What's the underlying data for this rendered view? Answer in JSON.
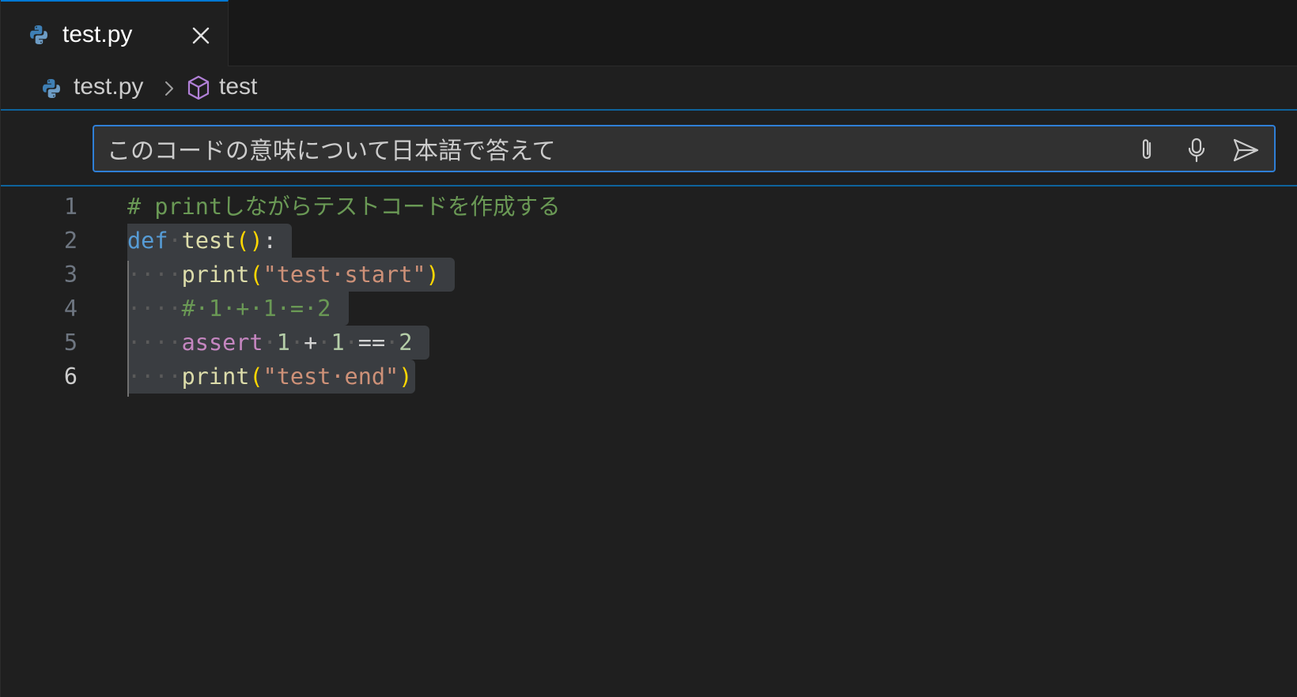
{
  "tab": {
    "label": "test.py",
    "icon": "python-icon"
  },
  "breadcrumb": {
    "file": "test.py",
    "symbol": "test"
  },
  "chat": {
    "prompt": "このコードの意味について日本語で答えて",
    "attach_icon": "paperclip-icon",
    "mic_icon": "microphone-icon",
    "send_icon": "send-icon"
  },
  "editor": {
    "current_line": 6,
    "lines": [
      {
        "number": "1",
        "tokens": [
          [
            "# printしながらテストコードを作成する",
            "comment"
          ]
        ]
      },
      {
        "number": "2",
        "tokens": [
          [
            "def",
            "kw"
          ],
          [
            "·",
            "ws"
          ],
          [
            "test",
            "fn"
          ],
          [
            "()",
            "paren"
          ],
          [
            ":",
            "op"
          ]
        ]
      },
      {
        "number": "3",
        "tokens": [
          [
            "····",
            "ws"
          ],
          [
            "print",
            "fn"
          ],
          [
            "(",
            "paren"
          ],
          [
            "\"test·start\"",
            "str"
          ],
          [
            ")",
            "paren"
          ]
        ]
      },
      {
        "number": "4",
        "tokens": [
          [
            "····",
            "ws"
          ],
          [
            "#·1·+·1·=·2",
            "comment"
          ]
        ]
      },
      {
        "number": "5",
        "tokens": [
          [
            "····",
            "ws"
          ],
          [
            "assert",
            "ctrl"
          ],
          [
            "·",
            "ws"
          ],
          [
            "1",
            "num"
          ],
          [
            "·",
            "ws"
          ],
          [
            "+",
            "op"
          ],
          [
            "·",
            "ws"
          ],
          [
            "1",
            "num"
          ],
          [
            "·",
            "ws"
          ],
          [
            "==",
            "op"
          ],
          [
            "·",
            "ws"
          ],
          [
            "2",
            "num"
          ]
        ]
      },
      {
        "number": "6",
        "tokens": [
          [
            "····",
            "ws"
          ],
          [
            "print",
            "fn"
          ],
          [
            "(",
            "paren"
          ],
          [
            "\"test·end\"",
            "str"
          ],
          [
            ")",
            "paren"
          ]
        ]
      }
    ]
  },
  "colors": {
    "accent": "#0078d4",
    "background": "#1f1f1f",
    "selection": "#3a3d41",
    "comment": "#6a9955",
    "keyword": "#569cd6",
    "function": "#dcdcaa",
    "string": "#ce9178",
    "control": "#c586c0",
    "number": "#b5cea8"
  }
}
